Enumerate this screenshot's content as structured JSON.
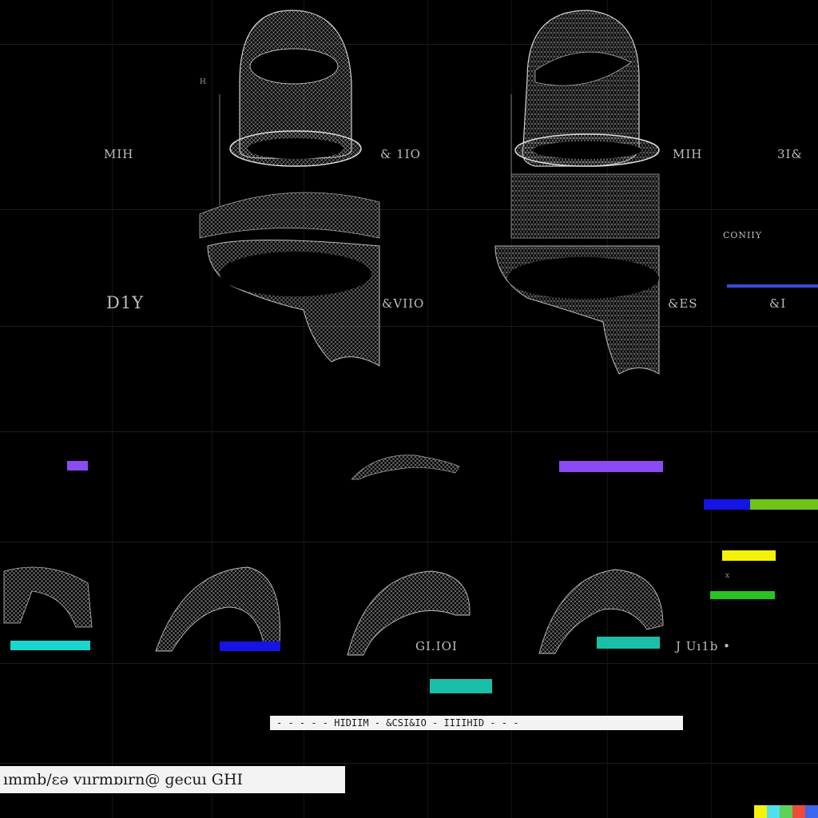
{
  "labels": {
    "l1": "MIH",
    "l2": "& 1IO",
    "l3": "MIH",
    "l4": "3I&",
    "l5": "CONIIY",
    "l6": "D1Y",
    "l7": "&VIIO",
    "l8": "&ES",
    "l9": "&I",
    "l10": "GI.IOI",
    "l11": "J Uı1b •",
    "l12": "x",
    "l13": "H"
  },
  "bottom_strip_1": "- - - - -  HIDIIM  - &CSI&IO  - IIIIHID  - - -",
  "bottom_strip_2": "ımmb/ɛə vıırmɒırn@ ɡecuı GHI",
  "colors": {
    "purple": "#8a4bf0",
    "blue": "#1414e6",
    "green": "#6fc417",
    "yellow": "#f5f10a",
    "bright_green": "#27c41f",
    "cyan": "#19d6cf",
    "teal": "#1abfa8",
    "slate": "#3b4bd6"
  },
  "icons": [
    "mesh-render-icon",
    "watermark-icon"
  ]
}
